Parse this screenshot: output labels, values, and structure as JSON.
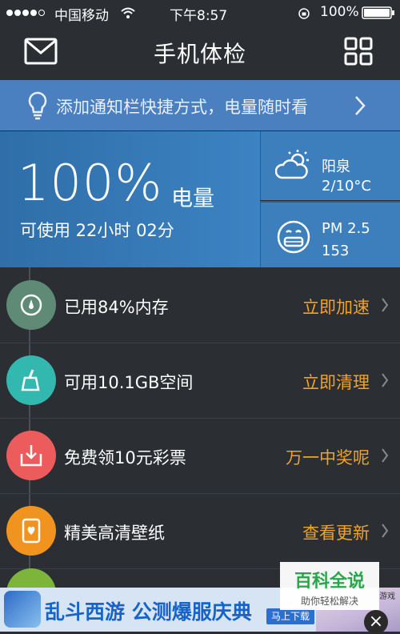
{
  "status_bar": {
    "carrier": "中国移动",
    "time": "下午8:57",
    "battery": "100%"
  },
  "header": {
    "title": "手机体检"
  },
  "banner": {
    "text": "添加通知栏快捷方式，电量随时看"
  },
  "battery_panel": {
    "percent": "100%",
    "label": "电量",
    "remaining": "可使用 22小时 02分",
    "level": 1.0
  },
  "weather": {
    "city": "阳泉",
    "temp": "2/10°C"
  },
  "air": {
    "label": "PM 2.5",
    "value": "153"
  },
  "list": [
    {
      "label": "已用84%内存",
      "action": "立即加速",
      "color": "#5f8b76",
      "icon": "gauge-icon"
    },
    {
      "label": "可用10.1GB空间",
      "action": "立即清理",
      "color": "#33b8b0",
      "icon": "broom-icon"
    },
    {
      "label": "免费领10元彩票",
      "action": "万一中奖呢",
      "color": "#ec5c5c",
      "icon": "download-box-icon"
    },
    {
      "label": "精美高清壁纸",
      "action": "查看更新",
      "color": "#f0931f",
      "icon": "wallpaper-icon"
    }
  ],
  "ad": {
    "text": "乱斗西游 公测爆服庆典",
    "download": "马上下载",
    "close": "×"
  },
  "watermark": {
    "title": "百科全说",
    "subtitle": "助你轻松解决",
    "game": "游戏"
  },
  "colors": {
    "accent": "#f0a327",
    "banner": "#4a7fc0",
    "panel": "#3c83c3",
    "background": "#2b2e33"
  }
}
